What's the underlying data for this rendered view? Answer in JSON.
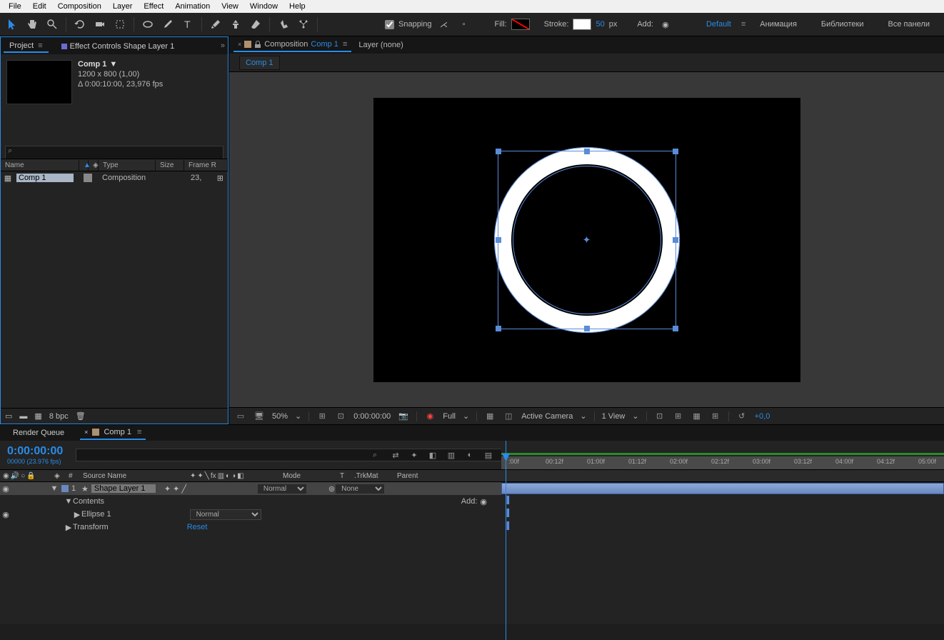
{
  "menu": {
    "file": "File",
    "edit": "Edit",
    "composition": "Composition",
    "layer": "Layer",
    "effect": "Effect",
    "animation": "Animation",
    "view": "View",
    "window": "Window",
    "help": "Help"
  },
  "toolbar": {
    "snapping": "Snapping",
    "fill_label": "Fill:",
    "stroke_label": "Stroke:",
    "stroke_value": "50",
    "stroke_unit": "px",
    "add_label": "Add:",
    "workspace_default": "Default",
    "workspace_animation": "Анимация",
    "workspace_libraries": "Библиотеки",
    "workspace_allpanels": "Все панели"
  },
  "project": {
    "tab_project": "Project",
    "tab_effectcontrols": "Effect Controls Shape Layer 1",
    "comp_name": "Comp 1",
    "comp_dims": "1200 x 800 (1,00)",
    "comp_duration": "Δ 0:00:10:00, 23,976 fps",
    "search_placeholder": "",
    "col_name": "Name",
    "col_type": "Type",
    "col_size": "Size",
    "col_framerate": "Frame R",
    "items": [
      {
        "name": "Comp 1",
        "type": "Composition",
        "framerate": "23,"
      }
    ],
    "bpc": "8 bpc"
  },
  "composition": {
    "tab_prefix": "Composition",
    "tab_name": "Comp 1",
    "layer_tab": "Layer (none)",
    "sub_tab": "Comp 1",
    "footer": {
      "zoom": "50%",
      "timecode": "0:00:00:00",
      "resolution": "Full",
      "camera": "Active Camera",
      "views": "1 View",
      "exposure": "+0,0"
    }
  },
  "timeline": {
    "tab_renderqueue": "Render Queue",
    "tab_comp": "Comp 1",
    "timecode": "0:00:00:00",
    "frames": "00000 (23.976 fps)",
    "col_num": "#",
    "col_source": "Source Name",
    "col_mode": "Mode",
    "col_t": "T",
    "col_trkmat": ".TrkMat",
    "col_parent": "Parent",
    "layers": {
      "shape_num": "1",
      "shape_name": "Shape Layer 1",
      "shape_mode": "Normal",
      "shape_trkmat": "None",
      "contents": "Contents",
      "add": "Add:",
      "ellipse": "Ellipse 1",
      "ellipse_mode": "Normal",
      "transform": "Transform",
      "reset": "Reset"
    },
    "ticks": [
      ":00f",
      "00:12f",
      "01:00f",
      "01:12f",
      "02:00f",
      "02:12f",
      "03:00f",
      "03:12f",
      "04:00f",
      "04:12f",
      "05:00f"
    ]
  }
}
